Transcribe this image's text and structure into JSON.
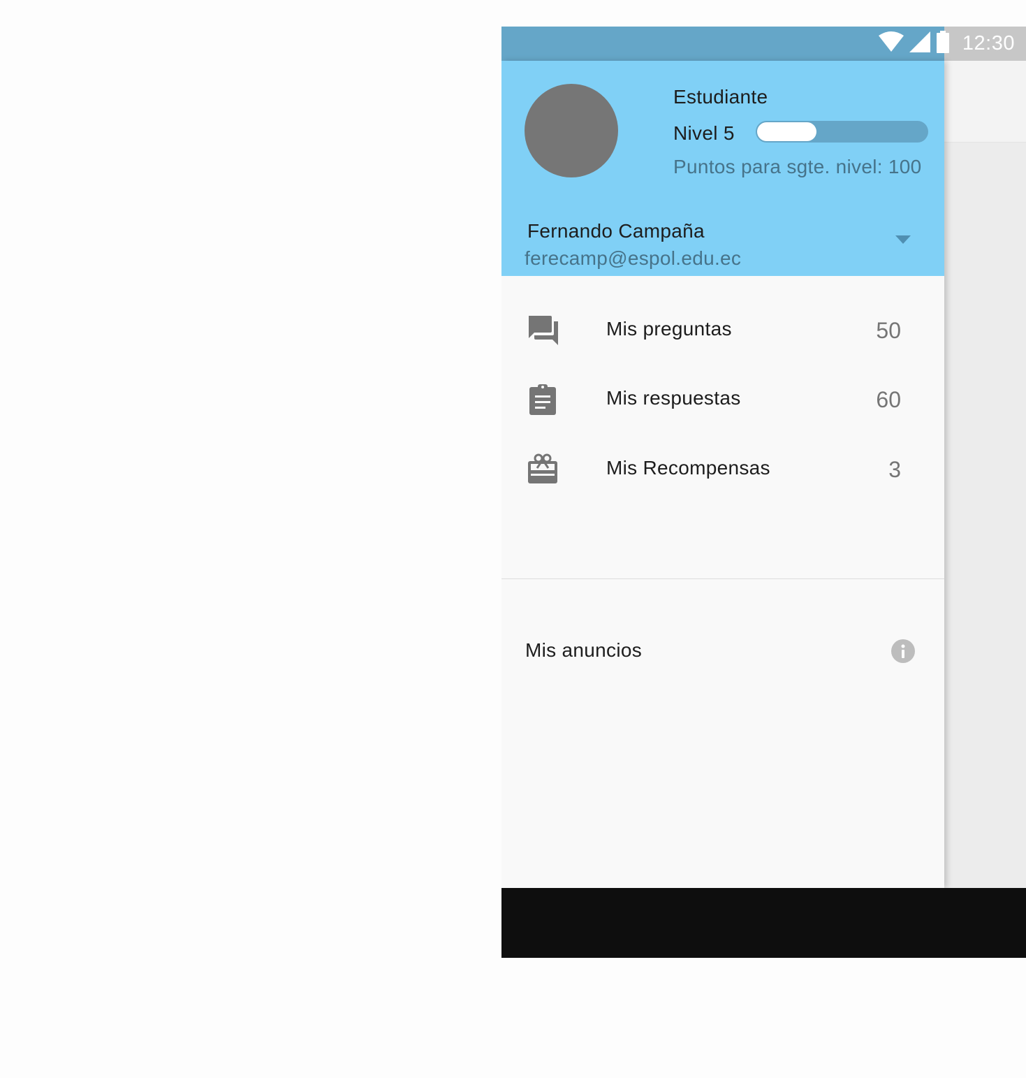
{
  "status_bar": {
    "time": "12:30",
    "icons": [
      "wifi-icon",
      "cell-signal-icon",
      "battery-icon"
    ],
    "color": "#65a6c8"
  },
  "drawer": {
    "header": {
      "background": "#80d0f6",
      "role": "Estudiante",
      "level_label": "Nivel 5",
      "level_progress_percent": 35,
      "points_text": "Puntos para sgte. nivel: 100",
      "user_name": "Fernando Campaña",
      "user_email": "ferecamp@espol.edu.ec"
    },
    "menu": [
      {
        "icon": "forum-icon",
        "label": "Mis preguntas",
        "count": "50"
      },
      {
        "icon": "assignment-icon",
        "label": "Mis respuestas",
        "count": "60"
      },
      {
        "icon": "redeem-icon",
        "label": "Mis Recompensas",
        "count": "3"
      }
    ],
    "ads": {
      "label": "Mis anuncios",
      "icon": "info-icon"
    }
  }
}
